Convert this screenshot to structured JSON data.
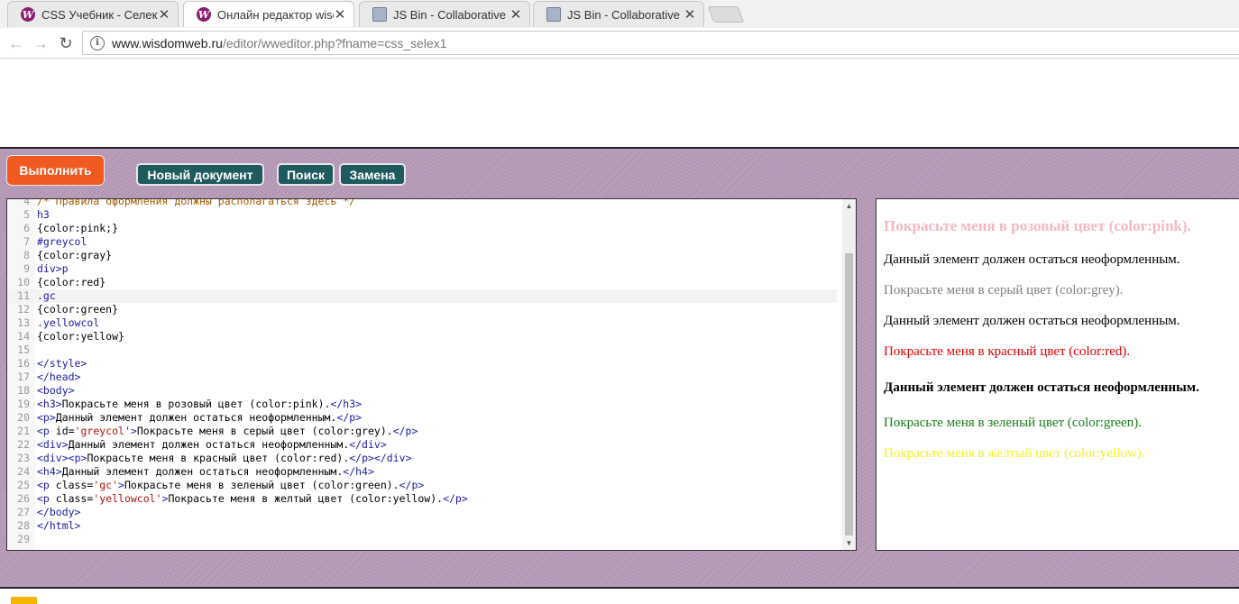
{
  "browser": {
    "tabs": [
      {
        "label": "CSS Учебник - Селектор",
        "icon": "wisdomweb-icon",
        "active": false
      },
      {
        "label": "Онлайн редактор wisdo",
        "icon": "wisdomweb-icon",
        "active": true
      },
      {
        "label": "JS Bin - Collaborative Jav",
        "icon": "jsbin-icon",
        "active": false
      },
      {
        "label": "JS Bin - Collaborative Jav",
        "icon": "jsbin-icon",
        "active": false
      }
    ],
    "url_host": "www.wisdomweb.ru",
    "url_path": "/editor/wweditor.php?fname=css_selex1"
  },
  "editor": {
    "run_label": "Выполнить",
    "new_doc_label": "Новый документ",
    "search_label": "Поиск",
    "replace_label": "Замена",
    "code_lines": [
      {
        "n": "4",
        "text": "/* Правила оформления должны располагаться здесь */"
      },
      {
        "n": "5",
        "text": "h3"
      },
      {
        "n": "6",
        "text": "{color:pink;}"
      },
      {
        "n": "7",
        "text": "#greycol"
      },
      {
        "n": "8",
        "text": "{color:gray}"
      },
      {
        "n": "9",
        "text": "div>p"
      },
      {
        "n": "10",
        "text": "{color:red}"
      },
      {
        "n": "11",
        "text": ".gc"
      },
      {
        "n": "12",
        "text": "{color:green}"
      },
      {
        "n": "13",
        "text": ".yellowcol"
      },
      {
        "n": "14",
        "text": "{color:yellow}"
      },
      {
        "n": "15",
        "text": ""
      },
      {
        "n": "16",
        "text": "</style>"
      },
      {
        "n": "17",
        "text": "</head>"
      },
      {
        "n": "18",
        "text": "<body>"
      },
      {
        "n": "19",
        "text": "<h3>Покрасьте меня в розовый цвет (color:pink).</h3>"
      },
      {
        "n": "20",
        "text": "<p>Данный элемент должен остаться неоформленным.</p>"
      },
      {
        "n": "21",
        "text": "<p id='greycol'>Покрасьте меня в серый цвет (color:grey).</p>"
      },
      {
        "n": "22",
        "text": "<div>Данный элемент должен остаться неоформленным.</div>"
      },
      {
        "n": "23",
        "text": "<div><p>Покрасьте меня в красный цвет (color:red).</p></div>"
      },
      {
        "n": "24",
        "text": "<h4>Данный элемент должен остаться неоформленным.</h4>"
      },
      {
        "n": "25",
        "text": "<p class='gc'>Покрасьте меня в зеленый цвет (color:green).</p>"
      },
      {
        "n": "26",
        "text": "<p class='yellowcol'>Покрасьте меня в желтый цвет (color:yellow).</p>"
      },
      {
        "n": "27",
        "text": "</body>"
      },
      {
        "n": "28",
        "text": "</html>"
      },
      {
        "n": "29",
        "text": ""
      }
    ],
    "highlighted_line": "11"
  },
  "preview": {
    "h3": "Покрасьте меня в розовый цвет (color:pink).",
    "p1": "Данный элемент должен остаться неоформленным.",
    "grey": "Покрасьте меня в серый цвет (color:grey).",
    "div": "Данный элемент должен остаться неоформленным.",
    "red": "Покрасьте меня в красный цвет (color:red).",
    "h4": "Данный элемент должен остаться неоформленным.",
    "green": "Покрасьте меня в зеленый цвет (color:green).",
    "yellow": "Покрасьте меня в желтый цвет (color:yellow).",
    "colors": {
      "pink": "#f4b8c4",
      "grey": "#808080",
      "red": "#dd0000",
      "green": "#1c7a1c",
      "yellow": "#f2f22a"
    }
  }
}
